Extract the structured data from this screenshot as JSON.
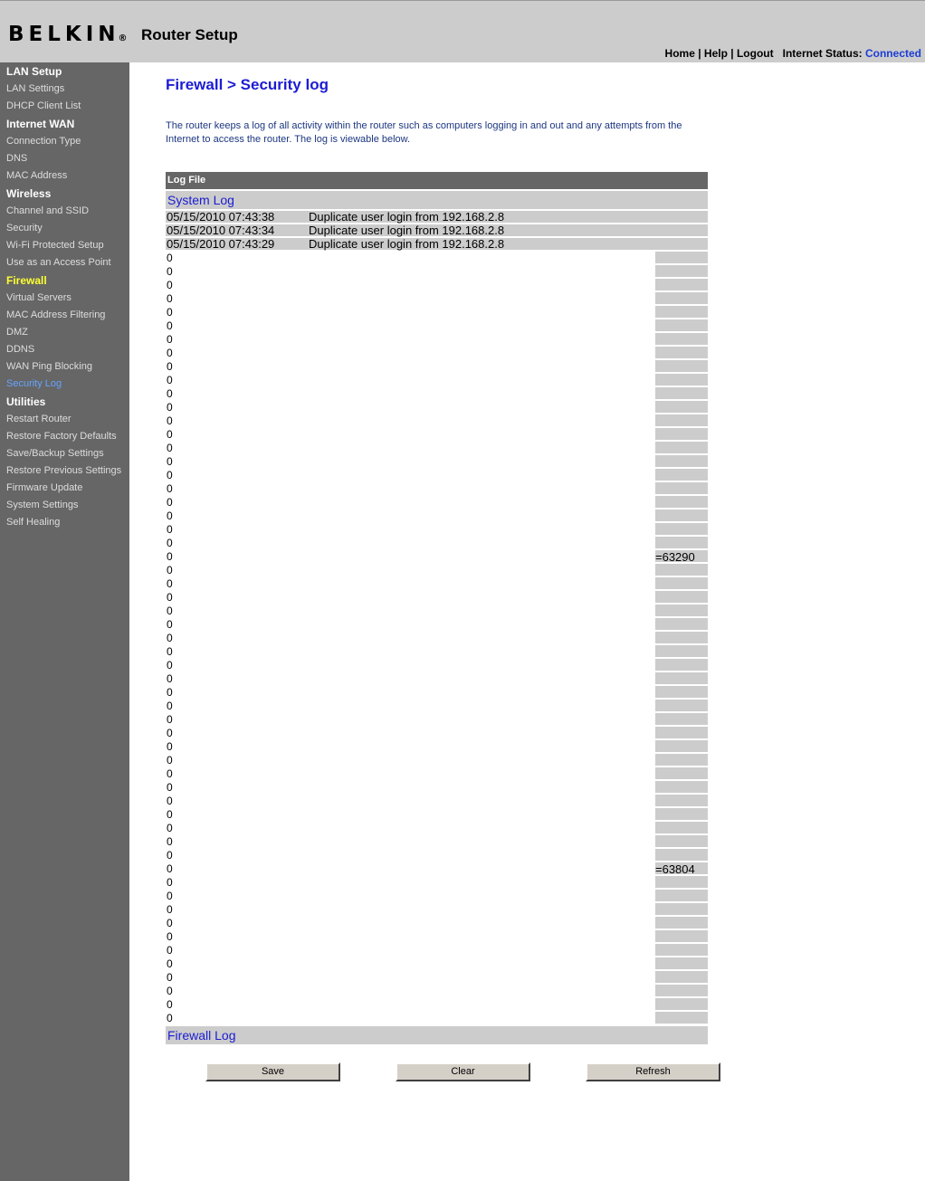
{
  "header": {
    "brand": "BELKIN",
    "brand_mark": "®",
    "title": "Router Setup",
    "nav": {
      "home": "Home",
      "help": "Help",
      "logout": "Logout",
      "sep": " | "
    },
    "status_label": "Internet Status: ",
    "status_value": "Connected"
  },
  "sidebar": {
    "sections": [
      {
        "title": "LAN Setup",
        "items": [
          "LAN Settings",
          "DHCP Client List"
        ]
      },
      {
        "title": "Internet WAN",
        "items": [
          "Connection Type",
          "DNS",
          "MAC Address"
        ]
      },
      {
        "title": "Wireless",
        "items": [
          "Channel and SSID",
          "Security",
          "Wi-Fi Protected Setup",
          "Use as an Access Point"
        ]
      },
      {
        "title": "Firewall",
        "items": [
          "Virtual Servers",
          "MAC Address Filtering",
          "DMZ",
          "DDNS",
          "WAN Ping Blocking",
          "Security Log"
        ]
      },
      {
        "title": "Utilities",
        "items": [
          "Restart Router",
          "Restore Factory Defaults",
          "Save/Backup Settings",
          "Restore Previous Settings",
          "Firmware Update",
          "System Settings",
          "Self Healing"
        ]
      }
    ],
    "active_section": "Firewall",
    "current_item": "Security Log"
  },
  "main": {
    "heading": "Firewall > Security log",
    "description": "The router keeps a log of all activity within the router such as computers logging in and out and any attempts from the Internet to access the router. The log is viewable below.",
    "log": {
      "header": "Log File",
      "system_log_title": "System Log",
      "entries": [
        {
          "time": "05/15/2010 07:43:38",
          "message": "Duplicate user login from 192.168.2.8"
        },
        {
          "time": "05/15/2010 07:43:34",
          "message": "Duplicate user login from 192.168.2.8"
        },
        {
          "time": "05/15/2010 07:43:29",
          "message": "Duplicate user login from 192.168.2.8"
        }
      ],
      "zero_value": "0",
      "zero_count": 57,
      "edge_values": [
        {
          "row": 22,
          "text": "=63290"
        },
        {
          "row": 45,
          "text": "=63804"
        }
      ],
      "firewall_log_title": "Firewall Log"
    },
    "buttons": {
      "save": "Save",
      "clear": "Clear",
      "refresh": "Refresh"
    }
  }
}
